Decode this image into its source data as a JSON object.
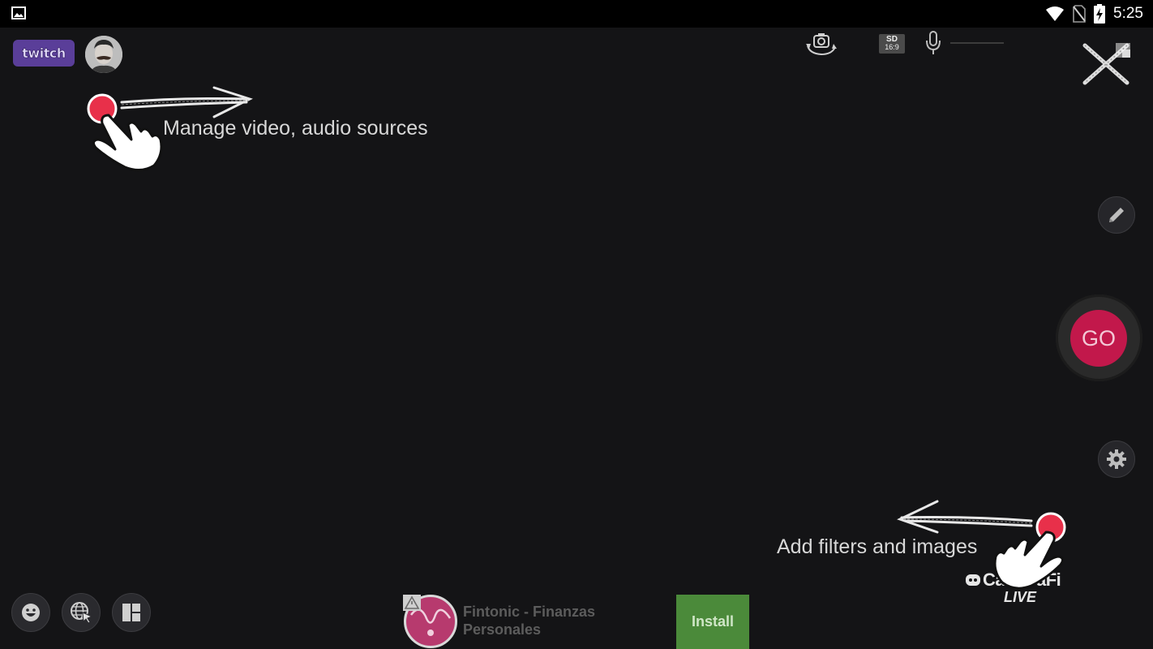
{
  "status_bar": {
    "time": "5:25",
    "icons": [
      "gallery-icon",
      "wifi-icon",
      "no-sim-icon",
      "battery-charging-icon"
    ]
  },
  "top_left": {
    "service_logo": "twitch",
    "avatar_icon": "user-avatar"
  },
  "top_right": {
    "camera_switch_icon": "camera-switch-icon",
    "resolution_badge": {
      "quality": "SD",
      "aspect": "16:9"
    },
    "mic_icon": "microphone-icon",
    "close_icon": "close-icon"
  },
  "right_rail": {
    "pencil_icon": "pencil-icon",
    "go_label": "GO",
    "settings_icon": "gear-icon"
  },
  "bottom_left": {
    "buttons": [
      "emoji-icon",
      "globe-cursor-icon",
      "layout-icon"
    ]
  },
  "hints": {
    "sources": "Manage video, audio sources",
    "filters": "Add filters and images"
  },
  "watermark": {
    "name": "CameraFi",
    "live": "LIVE"
  },
  "ad": {
    "title": "Fintonic - Finanzas Personales",
    "install_label": "Install"
  },
  "colors": {
    "background": "#141416",
    "go_button": "#c2184b",
    "twitch": "#5a3e99",
    "install": "#4b8a3a",
    "hint_dot": "#e8304a"
  }
}
